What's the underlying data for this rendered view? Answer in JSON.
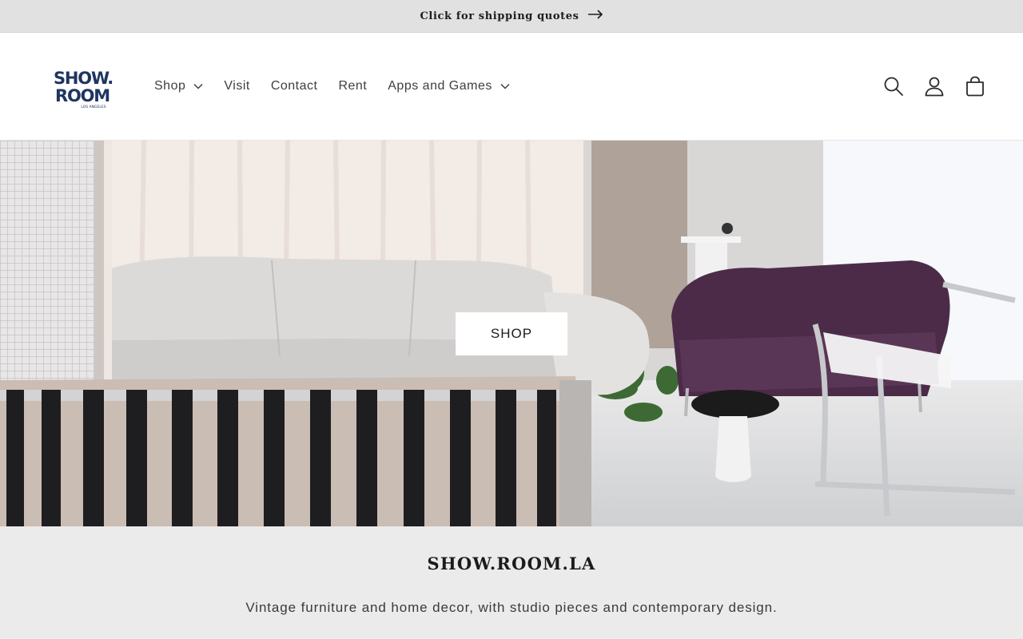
{
  "announcement": {
    "text": "Click for shipping quotes"
  },
  "header": {
    "logo": {
      "line1": "SHOW.",
      "line2": "ROOM",
      "tagline": "LOS ANGELES",
      "color": "#1f3561"
    },
    "nav": [
      {
        "label": "Shop",
        "has_dropdown": true
      },
      {
        "label": "Visit",
        "has_dropdown": false
      },
      {
        "label": "Contact",
        "has_dropdown": false
      },
      {
        "label": "Rent",
        "has_dropdown": false
      },
      {
        "label": "Apps and Games",
        "has_dropdown": true
      }
    ],
    "icons": [
      "search-icon",
      "account-icon",
      "cart-icon"
    ]
  },
  "hero": {
    "button_label": "SHOP"
  },
  "intro": {
    "title": "SHOW.ROOM.LA",
    "text": "Vintage furniture and home decor, with studio pieces and contemporary design."
  }
}
